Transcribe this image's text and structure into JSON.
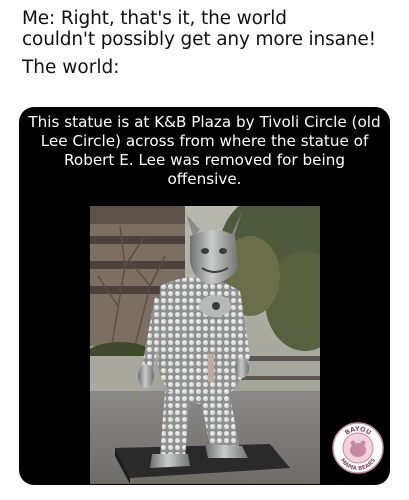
{
  "meme": {
    "top_line_1": "Me: Right, that's it, the world",
    "top_line_2": "couldn't possibly get any more insane!",
    "top_line_3": "The world:"
  },
  "caption": {
    "text": "This statue is at K&B Plaza by Tivoli Circle (old Lee Circle) across from where the statue of Robert E. Lee was removed for being offensive."
  },
  "photo": {
    "subject": "silver horned creature statue"
  },
  "watermark": {
    "top_text": "BAYOU",
    "bottom_text": "MAMA BEARS",
    "ring_color": "#c6899f",
    "fill_color": "#f3d1dc"
  }
}
